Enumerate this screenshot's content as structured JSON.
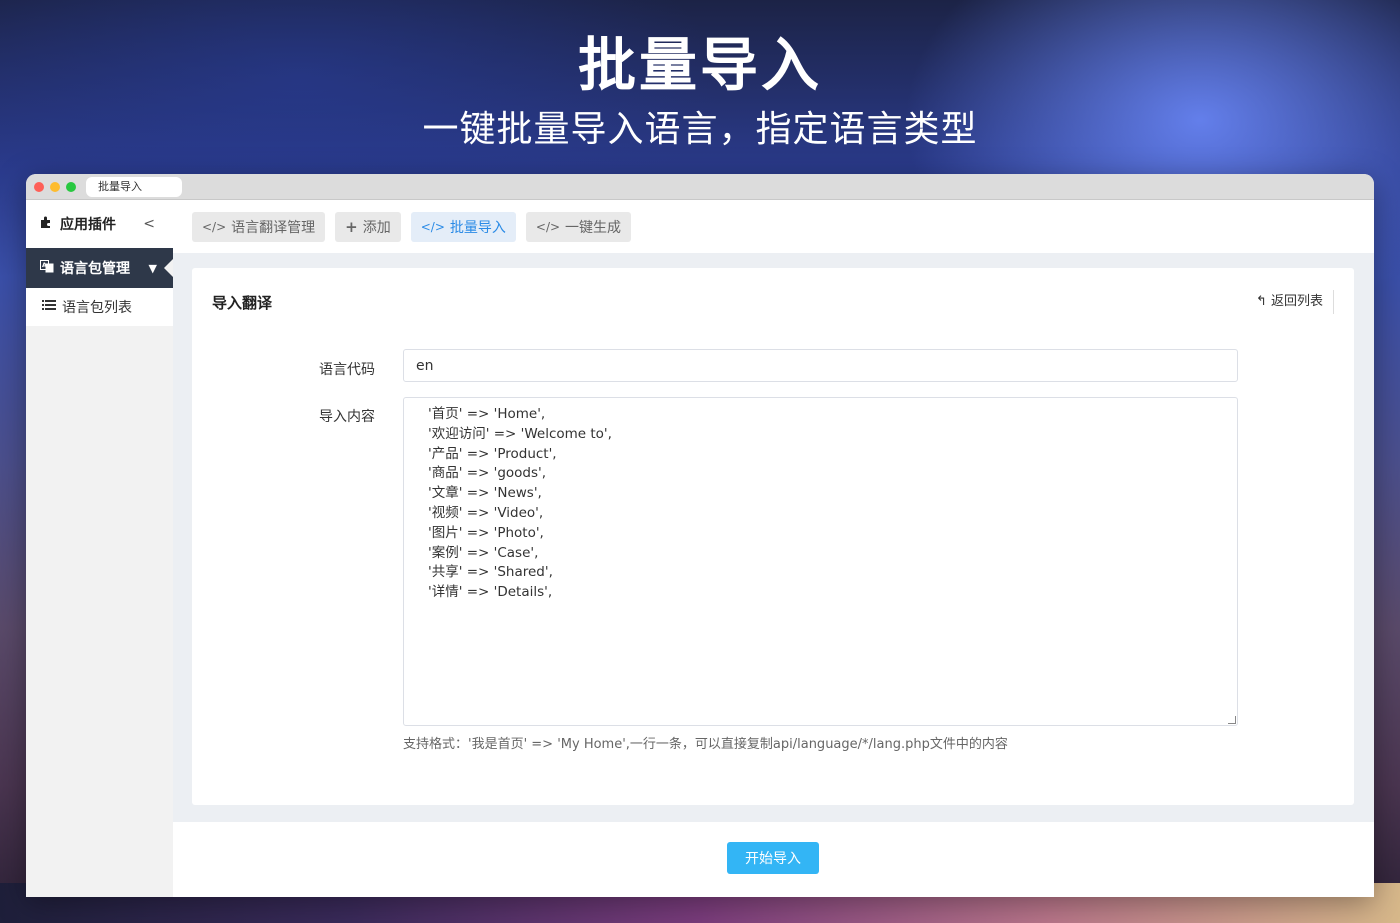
{
  "hero": {
    "title": "批量导入",
    "subtitle": "一键批量导入语言，指定语言类型"
  },
  "browser": {
    "tab_title": "批量导入"
  },
  "sidebar": {
    "header_label": "应用插件",
    "header_chevron": "<",
    "active_item": "语言包管理",
    "sub_item": "语言包列表"
  },
  "topnav": [
    {
      "icon": "</>",
      "label": "语言翻译管理",
      "active": false
    },
    {
      "icon": "+",
      "label": "添加",
      "active": false
    },
    {
      "icon": "</>",
      "label": "批量导入",
      "active": true
    },
    {
      "icon": "</>",
      "label": "一键生成",
      "active": false
    }
  ],
  "card": {
    "title": "导入翻译",
    "back_label": "返回列表"
  },
  "form": {
    "lang_code_label": "语言代码",
    "lang_code_value": "en",
    "content_label": "导入内容",
    "content_value": "'首页' => 'Home',\n'欢迎访问' => 'Welcome to',\n'产品' => 'Product',\n'商品' => 'goods',\n'文章' => 'News',\n'视频' => 'Video',\n'图片' => 'Photo',\n'案例' => 'Case',\n'共享' => 'Shared',\n'详情' => 'Details',",
    "hint": "支持格式：'我是首页' => 'My Home',一行一条，可以直接复制api/language/*/lang.php文件中的内容"
  },
  "footer": {
    "submit_label": "开始导入"
  },
  "colors": {
    "accent": "#33b5f5",
    "nav_active": "#2b8be6",
    "sidebar_active_bg": "#2e3849"
  }
}
